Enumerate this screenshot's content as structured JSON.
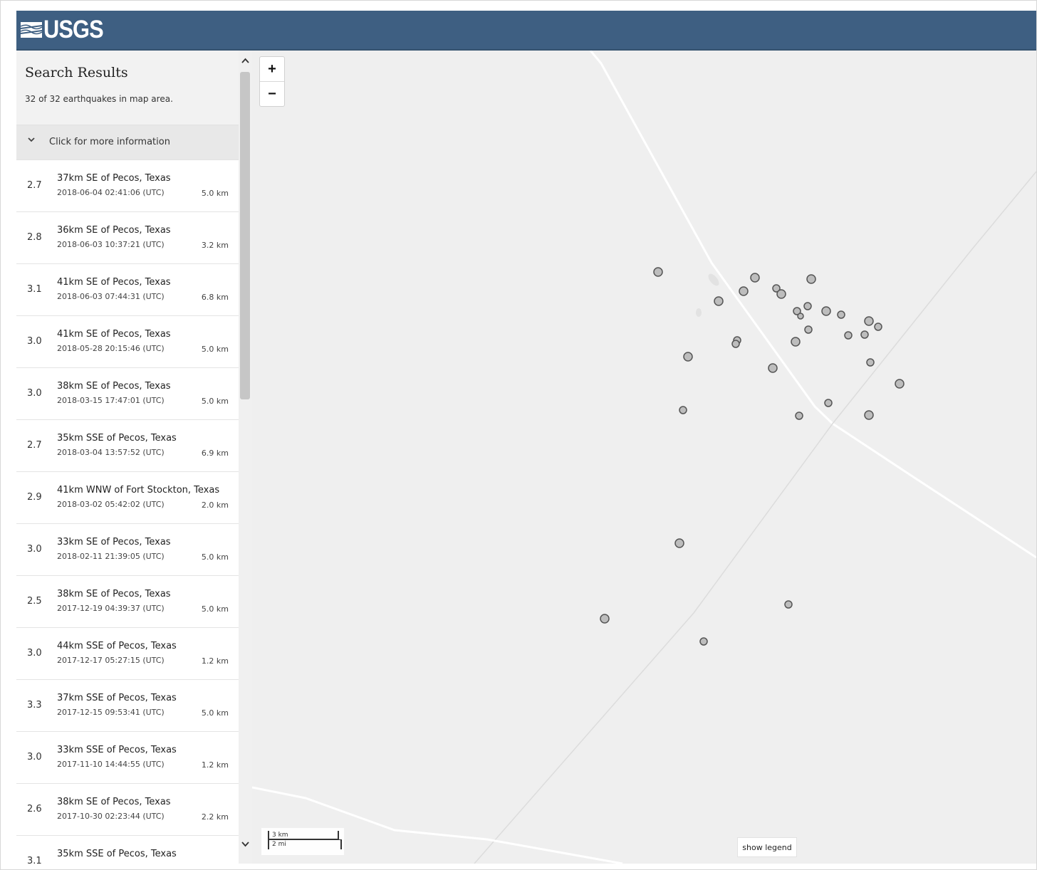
{
  "header": {
    "logo_text": "USGS",
    "color": "#3e5f82"
  },
  "results": {
    "title": "Search Results",
    "count_text": "32 of 32 earthquakes in map area.",
    "more_info_label": "Click for more information"
  },
  "earthquakes": [
    {
      "mag": "2.7",
      "place": "37km SE of Pecos, Texas",
      "time": "2018-06-04 02:41:06 (UTC)",
      "depth": "5.0 km"
    },
    {
      "mag": "2.8",
      "place": "36km SE of Pecos, Texas",
      "time": "2018-06-03 10:37:21 (UTC)",
      "depth": "3.2 km"
    },
    {
      "mag": "3.1",
      "place": "41km SE of Pecos, Texas",
      "time": "2018-06-03 07:44:31 (UTC)",
      "depth": "6.8 km"
    },
    {
      "mag": "3.0",
      "place": "41km SE of Pecos, Texas",
      "time": "2018-05-28 20:15:46 (UTC)",
      "depth": "5.0 km"
    },
    {
      "mag": "3.0",
      "place": "38km SE of Pecos, Texas",
      "time": "2018-03-15 17:47:01 (UTC)",
      "depth": "5.0 km"
    },
    {
      "mag": "2.7",
      "place": "35km SSE of Pecos, Texas",
      "time": "2018-03-04 13:57:52 (UTC)",
      "depth": "6.9 km"
    },
    {
      "mag": "2.9",
      "place": "41km WNW of Fort Stockton, Texas",
      "time": "2018-03-02 05:42:02 (UTC)",
      "depth": "2.0 km"
    },
    {
      "mag": "3.0",
      "place": "33km SE of Pecos, Texas",
      "time": "2018-02-11 21:39:05 (UTC)",
      "depth": "5.0 km"
    },
    {
      "mag": "2.5",
      "place": "38km SE of Pecos, Texas",
      "time": "2017-12-19 04:39:37 (UTC)",
      "depth": "5.0 km"
    },
    {
      "mag": "3.0",
      "place": "44km SSE of Pecos, Texas",
      "time": "2017-12-17 05:27:15 (UTC)",
      "depth": "1.2 km"
    },
    {
      "mag": "3.3",
      "place": "37km SSE of Pecos, Texas",
      "time": "2017-12-15 09:53:41 (UTC)",
      "depth": "5.0 km"
    },
    {
      "mag": "3.0",
      "place": "33km SSE of Pecos, Texas",
      "time": "2017-11-10 14:44:55 (UTC)",
      "depth": "1.2 km"
    },
    {
      "mag": "2.6",
      "place": "38km SE of Pecos, Texas",
      "time": "2017-10-30 02:23:44 (UTC)",
      "depth": "2.2 km"
    },
    {
      "mag": "3.1",
      "place": "35km SSE of Pecos, Texas",
      "time": "",
      "depth": ""
    }
  ],
  "map": {
    "zoom_in": "+",
    "zoom_out": "−",
    "scale_km": "3 km",
    "scale_mi": "2 mi",
    "legend_button": "show legend",
    "marker_color": "#bdbdbd"
  }
}
